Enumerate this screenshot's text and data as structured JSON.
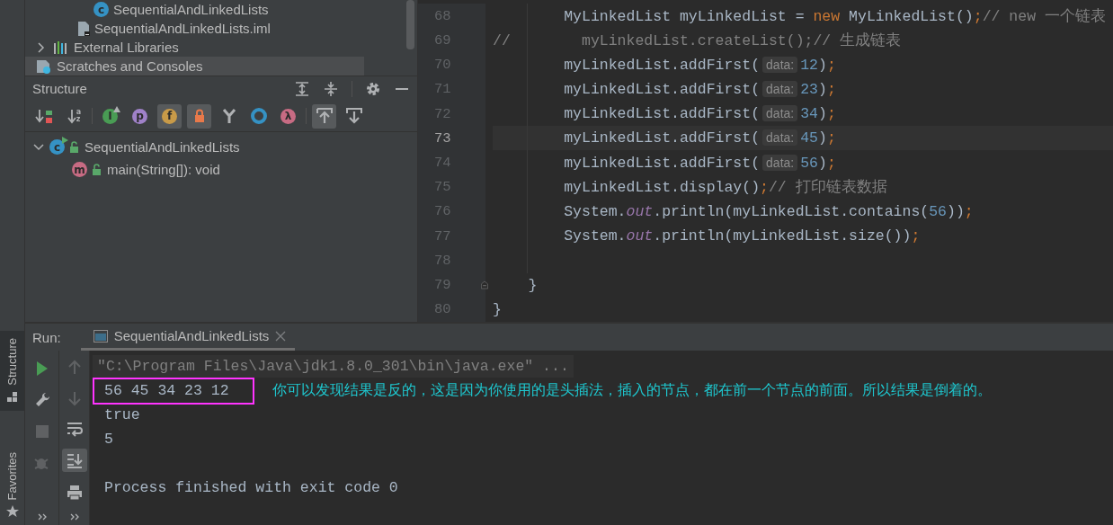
{
  "side_stripe": {
    "tabs": [
      {
        "label": "Structure",
        "kind": "structure",
        "selected": true
      },
      {
        "label": "Favorites",
        "kind": "favorites",
        "selected": false
      }
    ]
  },
  "project_tree": {
    "items": [
      {
        "label": "SequentialAndLinkedLists",
        "kind": "class",
        "badge": "c",
        "selected": false
      },
      {
        "label": "SequentialAndLinkedLists.iml",
        "kind": "module-file",
        "selected": false
      },
      {
        "label": "External Libraries",
        "kind": "libraries",
        "expanded": false,
        "selected": false
      },
      {
        "label": "Scratches and Consoles",
        "kind": "scratches",
        "selected": true
      }
    ]
  },
  "structure": {
    "title": "Structure",
    "toolbar": [
      {
        "kind": "sort-visibility",
        "on": false
      },
      {
        "kind": "sort-alpha",
        "glyph": "az",
        "on": false
      },
      {
        "kind": "inherited",
        "glyph": "I",
        "on": false
      },
      {
        "kind": "property",
        "glyph": "p",
        "on": false
      },
      {
        "kind": "field",
        "glyph": "f",
        "on": true
      },
      {
        "kind": "non-public",
        "on": true
      },
      {
        "kind": "anonymous",
        "on": false
      },
      {
        "kind": "interface",
        "on": false
      },
      {
        "kind": "lambda",
        "glyph": "λ",
        "on": false
      },
      {
        "kind": "autoscroll-to-source",
        "on": true
      },
      {
        "kind": "autoscroll-from-source",
        "on": false
      }
    ],
    "tree": [
      {
        "label": "SequentialAndLinkedLists",
        "kind": "class",
        "badge": "c",
        "expanded": true,
        "children": [
          {
            "label": "main(String[]): void",
            "kind": "method",
            "badge": "m"
          }
        ]
      }
    ]
  },
  "editor": {
    "lines": [
      {
        "number": "68",
        "current": false,
        "fold_marker": false,
        "tokens": [
          {
            "kind": "plain",
            "text": "        MyLinkedList myLinkedList = "
          },
          {
            "kind": "keyword",
            "text": "new"
          },
          {
            "kind": "plain",
            "text": " MyLinkedList()"
          },
          {
            "kind": "keyword",
            "text": ";"
          },
          {
            "kind": "comment",
            "text": "// new 一个链表"
          }
        ]
      },
      {
        "number": "69",
        "current": false,
        "fold_marker": false,
        "tokens": [
          {
            "kind": "comment",
            "text": "//        myLinkedList.createList();// 生成链表"
          }
        ]
      },
      {
        "number": "70",
        "current": false,
        "fold_marker": false,
        "tokens": [
          {
            "kind": "plain",
            "text": "        myLinkedList.addFirst("
          },
          {
            "kind": "hint",
            "text": "data:"
          },
          {
            "kind": "number",
            "text": "12"
          },
          {
            "kind": "plain",
            "text": ")"
          },
          {
            "kind": "keyword",
            "text": ";"
          }
        ]
      },
      {
        "number": "71",
        "current": false,
        "fold_marker": false,
        "tokens": [
          {
            "kind": "plain",
            "text": "        myLinkedList.addFirst("
          },
          {
            "kind": "hint",
            "text": "data:"
          },
          {
            "kind": "number",
            "text": "23"
          },
          {
            "kind": "plain",
            "text": ")"
          },
          {
            "kind": "keyword",
            "text": ";"
          }
        ]
      },
      {
        "number": "72",
        "current": false,
        "fold_marker": false,
        "tokens": [
          {
            "kind": "plain",
            "text": "        myLinkedList.addFirst("
          },
          {
            "kind": "hint",
            "text": "data:"
          },
          {
            "kind": "number",
            "text": "34"
          },
          {
            "kind": "plain",
            "text": ")"
          },
          {
            "kind": "keyword",
            "text": ";"
          }
        ]
      },
      {
        "number": "73",
        "current": true,
        "fold_marker": false,
        "tokens": [
          {
            "kind": "plain",
            "text": "        myLinkedList.addFirst("
          },
          {
            "kind": "hint",
            "text": "data:"
          },
          {
            "kind": "number",
            "text": "45"
          },
          {
            "kind": "plain",
            "text": ")"
          },
          {
            "kind": "keyword",
            "text": ";"
          }
        ]
      },
      {
        "number": "74",
        "current": false,
        "fold_marker": false,
        "tokens": [
          {
            "kind": "plain",
            "text": "        myLinkedList.addFirst("
          },
          {
            "kind": "hint",
            "text": "data:"
          },
          {
            "kind": "number",
            "text": "56"
          },
          {
            "kind": "plain",
            "text": ")"
          },
          {
            "kind": "keyword",
            "text": ";"
          }
        ]
      },
      {
        "number": "75",
        "current": false,
        "fold_marker": false,
        "tokens": [
          {
            "kind": "plain",
            "text": "        myLinkedList.display()"
          },
          {
            "kind": "keyword",
            "text": ";"
          },
          {
            "kind": "comment",
            "text": "// 打印链表数据"
          }
        ]
      },
      {
        "number": "76",
        "current": false,
        "fold_marker": false,
        "tokens": [
          {
            "kind": "plain",
            "text": "        System."
          },
          {
            "kind": "static",
            "text": "out"
          },
          {
            "kind": "plain",
            "text": ".println(myLinkedList.contains("
          },
          {
            "kind": "number",
            "text": "56"
          },
          {
            "kind": "plain",
            "text": "))"
          },
          {
            "kind": "keyword",
            "text": ";"
          }
        ]
      },
      {
        "number": "77",
        "current": false,
        "fold_marker": false,
        "tokens": [
          {
            "kind": "plain",
            "text": "        System."
          },
          {
            "kind": "static",
            "text": "out"
          },
          {
            "kind": "plain",
            "text": ".println(myLinkedList.size())"
          },
          {
            "kind": "keyword",
            "text": ";"
          }
        ]
      },
      {
        "number": "78",
        "current": false,
        "fold_marker": false
      },
      {
        "number": "79",
        "current": false,
        "fold_marker": true,
        "tokens": [
          {
            "kind": "plain",
            "text": "    }"
          }
        ]
      },
      {
        "number": "80",
        "current": false,
        "fold_marker": false,
        "tokens": [
          {
            "kind": "plain",
            "text": "}"
          }
        ]
      }
    ]
  },
  "run_panel": {
    "label": "Run:",
    "tab": {
      "title": "SequentialAndLinkedLists",
      "selected": true
    },
    "left_toolbar": [
      {
        "kind": "run",
        "disabled": false
      },
      {
        "kind": "settings",
        "disabled": false
      },
      {
        "kind": "stop",
        "disabled": true
      },
      {
        "kind": "debug",
        "disabled": true
      }
    ],
    "right_toolbar": [
      {
        "kind": "up",
        "disabled": true,
        "on": false
      },
      {
        "kind": "down",
        "disabled": true,
        "on": false
      },
      {
        "kind": "soft-wrap",
        "disabled": false,
        "on": false
      },
      {
        "kind": "scroll-to-end",
        "disabled": false,
        "on": true
      },
      {
        "kind": "print",
        "disabled": false,
        "on": false
      }
    ],
    "console": [
      {
        "kind": "command",
        "text": "\"C:\\Program Files\\Java\\jdk1.8.0_301\\bin\\java.exe\" ...",
        "highlighted": false
      },
      {
        "kind": "output",
        "text": "56 45 34 23 12",
        "highlighted": true
      },
      {
        "kind": "output",
        "text": "true",
        "highlighted": false
      },
      {
        "kind": "output",
        "text": "5",
        "highlighted": false
      },
      {
        "kind": "blank",
        "highlighted": false
      },
      {
        "kind": "output",
        "text": "Process finished with exit code 0",
        "highlighted": false
      }
    ],
    "annotation": "你可以发现结果是反的，这是因为你使用的是头插法，插入的节点，都在前一个节点的前面。所以结果是倒着的。"
  }
}
